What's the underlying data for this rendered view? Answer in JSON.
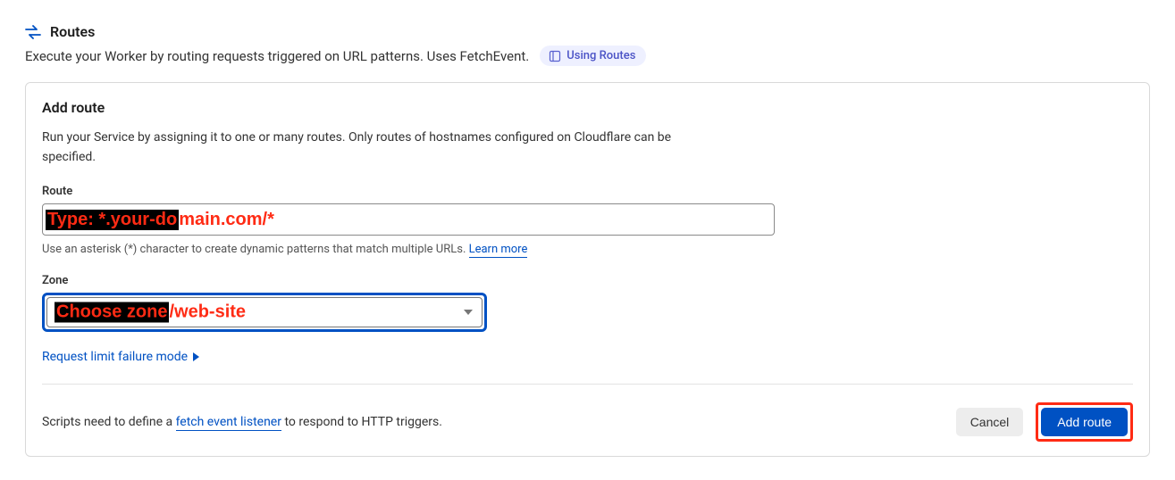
{
  "header": {
    "title": "Routes",
    "description": "Execute your Worker by routing requests triggered on URL patterns. Uses FetchEvent.",
    "pill_label": "Using Routes"
  },
  "card": {
    "title": "Add route",
    "description": "Run your Service by assigning it to one or many routes. Only routes of hostnames configured on Cloudflare can be specified."
  },
  "route_field": {
    "label": "Route",
    "overlay_highlight": "Type: *.your-do",
    "overlay_trail": "main.com/*",
    "helper_before": "Use an asterisk (*) character to create dynamic patterns that match multiple URLs. ",
    "learn_more": "Learn more"
  },
  "zone_field": {
    "label": "Zone",
    "overlay_highlight": "Choose zone",
    "overlay_trail": "/web-site"
  },
  "request_limit": {
    "label": "Request limit failure mode"
  },
  "footer": {
    "text_before": "Scripts need to define a ",
    "link": "fetch event listener",
    "text_after": " to respond to HTTP triggers.",
    "cancel": "Cancel",
    "add_route": "Add route"
  }
}
